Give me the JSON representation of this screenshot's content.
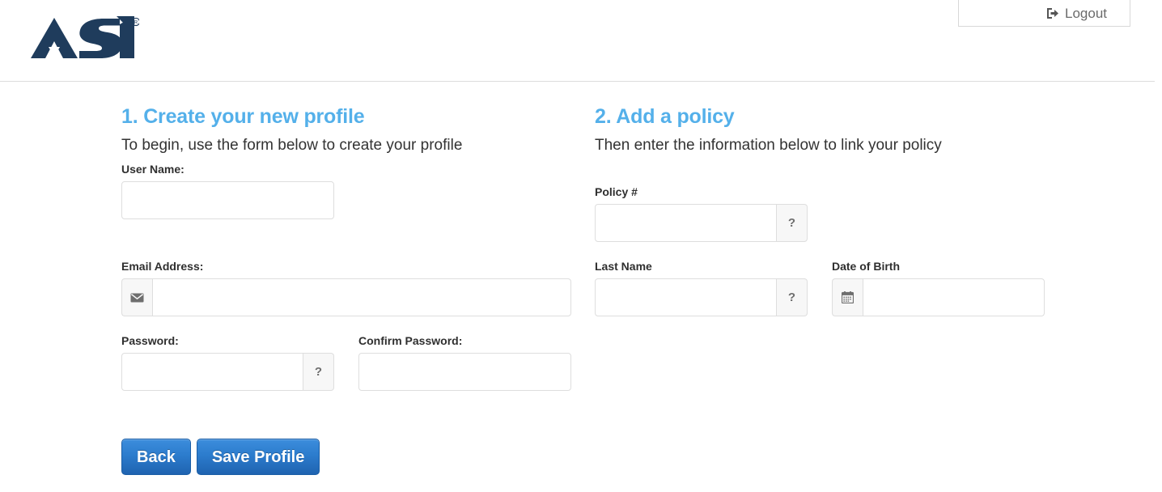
{
  "header": {
    "logo_alt": "ASI",
    "logo_color": "#1f3c5c",
    "logout_label": "Logout",
    "logout_icon": "sign-out-icon"
  },
  "colors": {
    "heading_blue": "#54b0ea",
    "button_blue": "#2c7ccd",
    "border_gray": "#dedede",
    "addon_bg": "#f7f7f7"
  },
  "steps": {
    "left": {
      "title": "1. Create your new profile",
      "subtitle": "To begin, use the form below to create your profile"
    },
    "right": {
      "title": "2. Add a policy",
      "subtitle": "Then enter the information below to link your policy"
    }
  },
  "fields": {
    "username": {
      "label": "User Name:",
      "value": "",
      "placeholder": ""
    },
    "email": {
      "label": "Email Address:",
      "value": "",
      "placeholder": "",
      "prefix_icon": "envelope-icon"
    },
    "password": {
      "label": "Password:",
      "value": "",
      "placeholder": "",
      "suffix_label": "?"
    },
    "confirm_password": {
      "label": "Confirm Password:",
      "value": "",
      "placeholder": ""
    },
    "policy_number": {
      "label": "Policy #",
      "value": "",
      "placeholder": "",
      "suffix_label": "?"
    },
    "last_name": {
      "label": "Last Name",
      "value": "",
      "placeholder": "",
      "suffix_label": "?"
    },
    "date_of_birth": {
      "label": "Date of Birth",
      "value": "",
      "placeholder": "",
      "prefix_icon": "calendar-icon"
    }
  },
  "actions": {
    "back_label": "Back",
    "save_label": "Save Profile"
  }
}
